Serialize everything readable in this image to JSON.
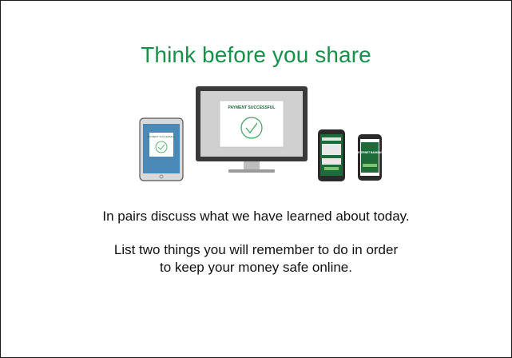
{
  "slide": {
    "title": "Think before you share",
    "illustration": {
      "tablet_screen_text": "PAYMENT SUCCESSFUL",
      "monitor_screen_text": "PAYMENT SUCCESSFUL",
      "phone_left_text": "",
      "phone_right_text": "INTERNET BANKING",
      "accent_color": "#1e6b3a",
      "check_color": "#3aa35b"
    },
    "body": {
      "line1": "In pairs discuss what we have learned about today.",
      "line2": "List two things you will remember to do in order",
      "line3": "to keep your money safe online."
    }
  }
}
